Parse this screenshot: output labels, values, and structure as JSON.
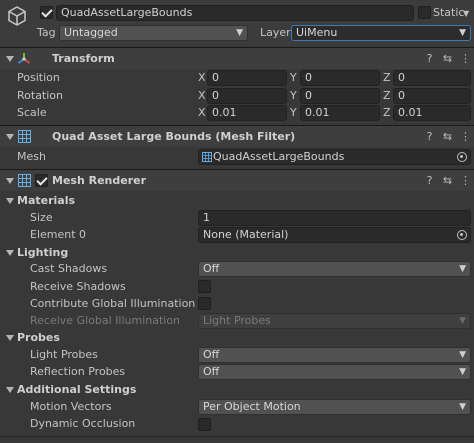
{
  "object": {
    "name": "QuadAssetLargeBounds",
    "active": true,
    "static_label": "Static",
    "tag_label": "Tag",
    "tag_value": "Untagged",
    "layer_label": "Layer",
    "layer_value": "UiMenu"
  },
  "transform": {
    "title": "Transform",
    "position": {
      "label": "Position",
      "x": "0",
      "y": "0",
      "z": "0"
    },
    "rotation": {
      "label": "Rotation",
      "x": "0",
      "y": "0",
      "z": "0"
    },
    "scale": {
      "label": "Scale",
      "x": "0.01",
      "y": "0.01",
      "z": "0.01"
    },
    "axis_x": "X",
    "axis_y": "Y",
    "axis_z": "Z"
  },
  "mesh_filter": {
    "title": "Quad Asset Large Bounds (Mesh Filter)",
    "mesh_label": "Mesh",
    "mesh_value": "QuadAssetLargeBounds"
  },
  "mesh_renderer": {
    "title": "Mesh Renderer",
    "enabled": true,
    "materials": {
      "label": "Materials",
      "size_label": "Size",
      "size_value": "1",
      "element0_label": "Element 0",
      "element0_value": "None (Material)"
    },
    "lighting": {
      "label": "Lighting",
      "cast_shadows_label": "Cast Shadows",
      "cast_shadows_value": "Off",
      "receive_shadows_label": "Receive Shadows",
      "contribute_gi_label": "Contribute Global Illumination",
      "receive_gi_label": "Receive Global Illumination",
      "receive_gi_value": "Light Probes"
    },
    "probes": {
      "label": "Probes",
      "light_probes_label": "Light Probes",
      "light_probes_value": "Off",
      "reflection_probes_label": "Reflection Probes",
      "reflection_probes_value": "Off"
    },
    "additional": {
      "label": "Additional Settings",
      "motion_vectors_label": "Motion Vectors",
      "motion_vectors_value": "Per Object Motion",
      "dynamic_occlusion_label": "Dynamic Occlusion"
    }
  },
  "icons": {
    "help": "?",
    "preset": "⇆",
    "menu": "⋮",
    "arrow": "▼"
  }
}
